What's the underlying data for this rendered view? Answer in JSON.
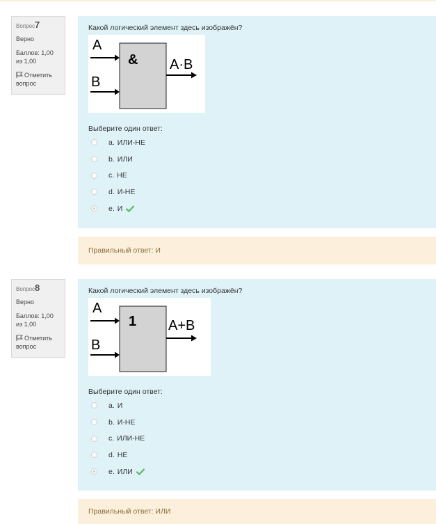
{
  "questions": [
    {
      "number_label": "Вопрос",
      "number": "7",
      "state": "Верно",
      "grade": "Баллов: 1,00 из 1,00",
      "flag_label": "Отметить вопрос",
      "text": "Какой логический элемент здесь изображён?",
      "diagram": {
        "in1": "A",
        "in2": "B",
        "gate_symbol": "&",
        "output": "A·B"
      },
      "prompt": "Выберите один ответ:",
      "options": [
        {
          "letter": "a.",
          "label": "ИЛИ-НЕ",
          "selected": false
        },
        {
          "letter": "b.",
          "label": "ИЛИ",
          "selected": false
        },
        {
          "letter": "c.",
          "label": "НЕ",
          "selected": false
        },
        {
          "letter": "d.",
          "label": "И-НЕ",
          "selected": false
        },
        {
          "letter": "e.",
          "label": "И",
          "selected": true
        }
      ],
      "feedback": "Правильный ответ: И"
    },
    {
      "number_label": "Вопрос",
      "number": "8",
      "state": "Верно",
      "grade": "Баллов: 1,00 из 1,00",
      "flag_label": "Отметить вопрос",
      "text": "Какой логический элемент здесь изображён?",
      "diagram": {
        "in1": "A",
        "in2": "B",
        "gate_symbol": "1",
        "output": "A+B"
      },
      "prompt": "Выберите один ответ:",
      "options": [
        {
          "letter": "a.",
          "label": "И",
          "selected": false
        },
        {
          "letter": "b.",
          "label": "И-НЕ",
          "selected": false
        },
        {
          "letter": "c.",
          "label": "ИЛИ-НЕ",
          "selected": false
        },
        {
          "letter": "d.",
          "label": "НЕ",
          "selected": false
        },
        {
          "letter": "e.",
          "label": "ИЛИ",
          "selected": true
        }
      ],
      "feedback": "Правильный ответ: ИЛИ"
    }
  ],
  "colors": {
    "content_bg": "#def2f8",
    "feedback_bg": "#fcefdc",
    "feedback_text": "#8a6d3b",
    "correct_check": "#5cb85c"
  },
  "icons": [
    "flag-icon",
    "check-icon",
    "radio-icon"
  ]
}
